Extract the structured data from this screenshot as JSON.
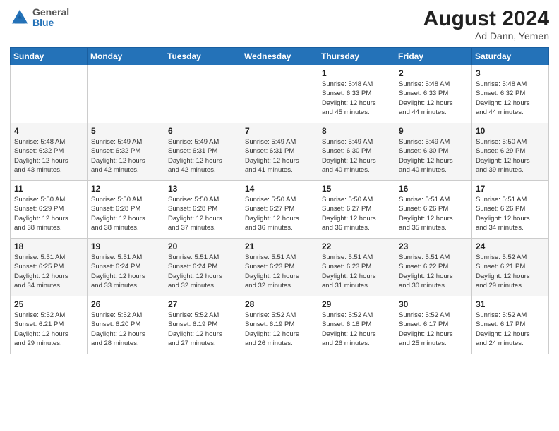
{
  "header": {
    "logo": {
      "general": "General",
      "blue": "Blue"
    },
    "title": "August 2024",
    "subtitle": "Ad Dann, Yemen"
  },
  "weekdays": [
    "Sunday",
    "Monday",
    "Tuesday",
    "Wednesday",
    "Thursday",
    "Friday",
    "Saturday"
  ],
  "weeks": [
    [
      {
        "day": "",
        "info": ""
      },
      {
        "day": "",
        "info": ""
      },
      {
        "day": "",
        "info": ""
      },
      {
        "day": "",
        "info": ""
      },
      {
        "day": "1",
        "info": "Sunrise: 5:48 AM\nSunset: 6:33 PM\nDaylight: 12 hours\nand 45 minutes."
      },
      {
        "day": "2",
        "info": "Sunrise: 5:48 AM\nSunset: 6:33 PM\nDaylight: 12 hours\nand 44 minutes."
      },
      {
        "day": "3",
        "info": "Sunrise: 5:48 AM\nSunset: 6:32 PM\nDaylight: 12 hours\nand 44 minutes."
      }
    ],
    [
      {
        "day": "4",
        "info": "Sunrise: 5:48 AM\nSunset: 6:32 PM\nDaylight: 12 hours\nand 43 minutes."
      },
      {
        "day": "5",
        "info": "Sunrise: 5:49 AM\nSunset: 6:32 PM\nDaylight: 12 hours\nand 42 minutes."
      },
      {
        "day": "6",
        "info": "Sunrise: 5:49 AM\nSunset: 6:31 PM\nDaylight: 12 hours\nand 42 minutes."
      },
      {
        "day": "7",
        "info": "Sunrise: 5:49 AM\nSunset: 6:31 PM\nDaylight: 12 hours\nand 41 minutes."
      },
      {
        "day": "8",
        "info": "Sunrise: 5:49 AM\nSunset: 6:30 PM\nDaylight: 12 hours\nand 40 minutes."
      },
      {
        "day": "9",
        "info": "Sunrise: 5:49 AM\nSunset: 6:30 PM\nDaylight: 12 hours\nand 40 minutes."
      },
      {
        "day": "10",
        "info": "Sunrise: 5:50 AM\nSunset: 6:29 PM\nDaylight: 12 hours\nand 39 minutes."
      }
    ],
    [
      {
        "day": "11",
        "info": "Sunrise: 5:50 AM\nSunset: 6:29 PM\nDaylight: 12 hours\nand 38 minutes."
      },
      {
        "day": "12",
        "info": "Sunrise: 5:50 AM\nSunset: 6:28 PM\nDaylight: 12 hours\nand 38 minutes."
      },
      {
        "day": "13",
        "info": "Sunrise: 5:50 AM\nSunset: 6:28 PM\nDaylight: 12 hours\nand 37 minutes."
      },
      {
        "day": "14",
        "info": "Sunrise: 5:50 AM\nSunset: 6:27 PM\nDaylight: 12 hours\nand 36 minutes."
      },
      {
        "day": "15",
        "info": "Sunrise: 5:50 AM\nSunset: 6:27 PM\nDaylight: 12 hours\nand 36 minutes."
      },
      {
        "day": "16",
        "info": "Sunrise: 5:51 AM\nSunset: 6:26 PM\nDaylight: 12 hours\nand 35 minutes."
      },
      {
        "day": "17",
        "info": "Sunrise: 5:51 AM\nSunset: 6:26 PM\nDaylight: 12 hours\nand 34 minutes."
      }
    ],
    [
      {
        "day": "18",
        "info": "Sunrise: 5:51 AM\nSunset: 6:25 PM\nDaylight: 12 hours\nand 34 minutes."
      },
      {
        "day": "19",
        "info": "Sunrise: 5:51 AM\nSunset: 6:24 PM\nDaylight: 12 hours\nand 33 minutes."
      },
      {
        "day": "20",
        "info": "Sunrise: 5:51 AM\nSunset: 6:24 PM\nDaylight: 12 hours\nand 32 minutes."
      },
      {
        "day": "21",
        "info": "Sunrise: 5:51 AM\nSunset: 6:23 PM\nDaylight: 12 hours\nand 32 minutes."
      },
      {
        "day": "22",
        "info": "Sunrise: 5:51 AM\nSunset: 6:23 PM\nDaylight: 12 hours\nand 31 minutes."
      },
      {
        "day": "23",
        "info": "Sunrise: 5:51 AM\nSunset: 6:22 PM\nDaylight: 12 hours\nand 30 minutes."
      },
      {
        "day": "24",
        "info": "Sunrise: 5:52 AM\nSunset: 6:21 PM\nDaylight: 12 hours\nand 29 minutes."
      }
    ],
    [
      {
        "day": "25",
        "info": "Sunrise: 5:52 AM\nSunset: 6:21 PM\nDaylight: 12 hours\nand 29 minutes."
      },
      {
        "day": "26",
        "info": "Sunrise: 5:52 AM\nSunset: 6:20 PM\nDaylight: 12 hours\nand 28 minutes."
      },
      {
        "day": "27",
        "info": "Sunrise: 5:52 AM\nSunset: 6:19 PM\nDaylight: 12 hours\nand 27 minutes."
      },
      {
        "day": "28",
        "info": "Sunrise: 5:52 AM\nSunset: 6:19 PM\nDaylight: 12 hours\nand 26 minutes."
      },
      {
        "day": "29",
        "info": "Sunrise: 5:52 AM\nSunset: 6:18 PM\nDaylight: 12 hours\nand 26 minutes."
      },
      {
        "day": "30",
        "info": "Sunrise: 5:52 AM\nSunset: 6:17 PM\nDaylight: 12 hours\nand 25 minutes."
      },
      {
        "day": "31",
        "info": "Sunrise: 5:52 AM\nSunset: 6:17 PM\nDaylight: 12 hours\nand 24 minutes."
      }
    ]
  ]
}
